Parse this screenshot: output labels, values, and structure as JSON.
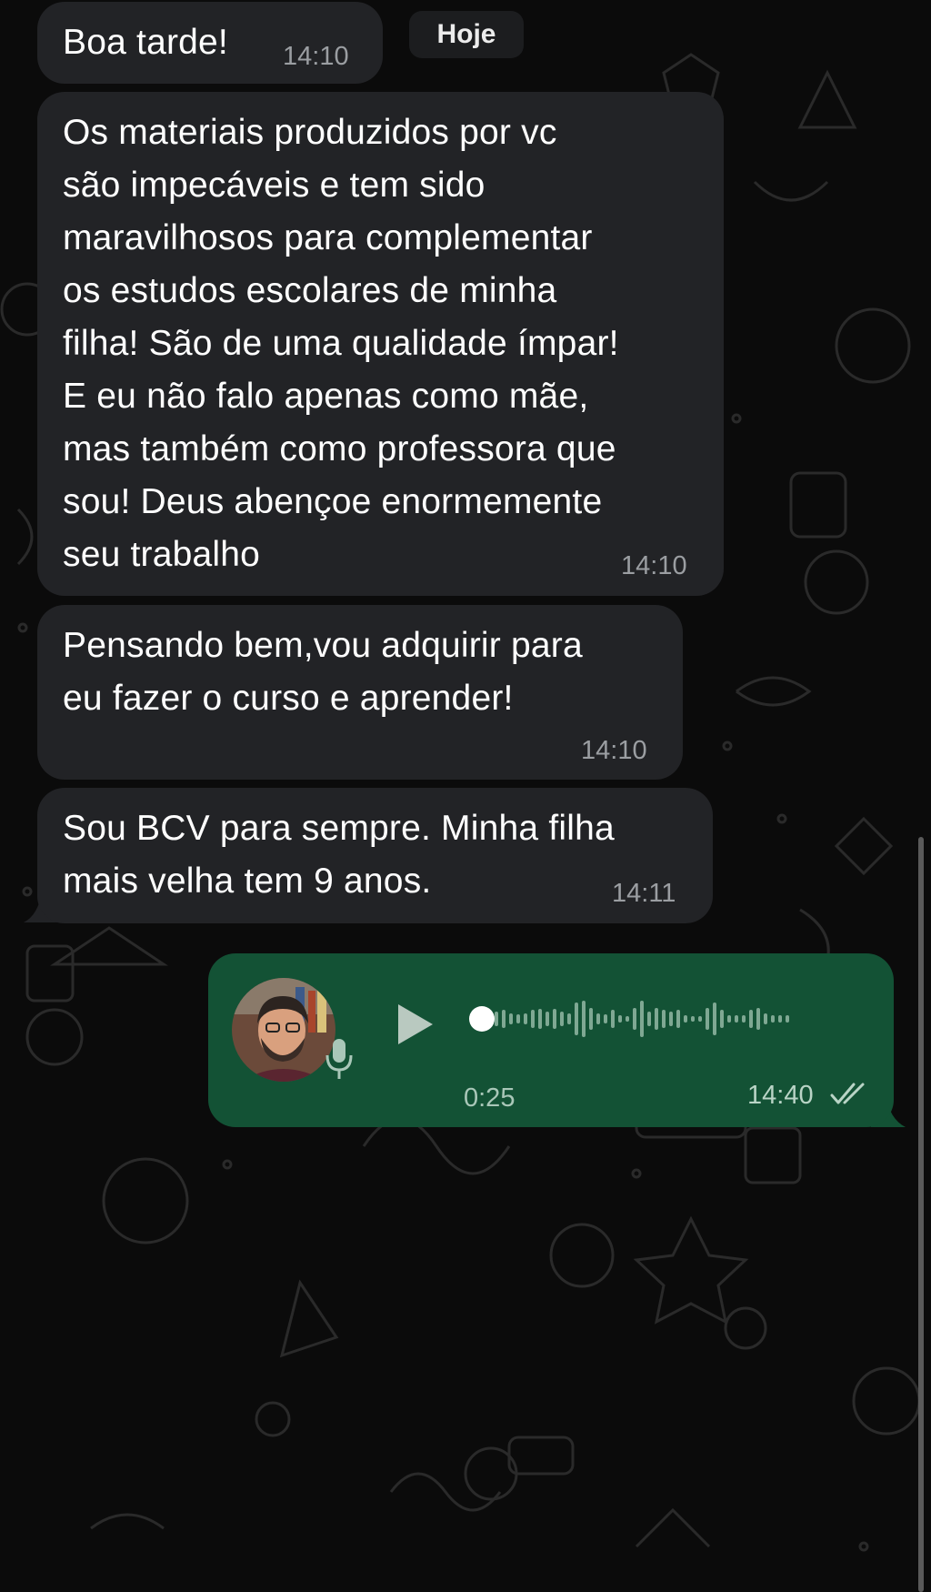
{
  "day_separator": "Hoje",
  "messages": [
    {
      "text": "Boa tarde!",
      "time": "14:10"
    },
    {
      "text": "Os materiais produzidos por vc\nsão impecáveis e tem sido\nmaravilhosos para complementar\nos estudos escolares de minha\nfilha! São de uma qualidade ímpar!\nE eu não falo apenas como mãe,\nmas também como professora que\nsou! Deus abençoe enormemente\nseu trabalho",
      "time": "14:10"
    },
    {
      "text": "Pensando bem,vou adquirir para\neu fazer o curso e aprender!",
      "time": "14:10"
    },
    {
      "text": "Sou BCV para sempre. Minha filha\nmais velha tem 9 anos.",
      "time": "14:11"
    }
  ],
  "voice_message": {
    "duration": "0:25",
    "time": "14:40",
    "played_fraction": 0.0,
    "status_icon": "double-check-icon",
    "avatar_icon": "avatar"
  },
  "colors": {
    "background": "#0b0b0b",
    "incoming_bubble": "#222326",
    "outgoing_bubble": "#135235",
    "timestamp": "#9b9ea2"
  }
}
